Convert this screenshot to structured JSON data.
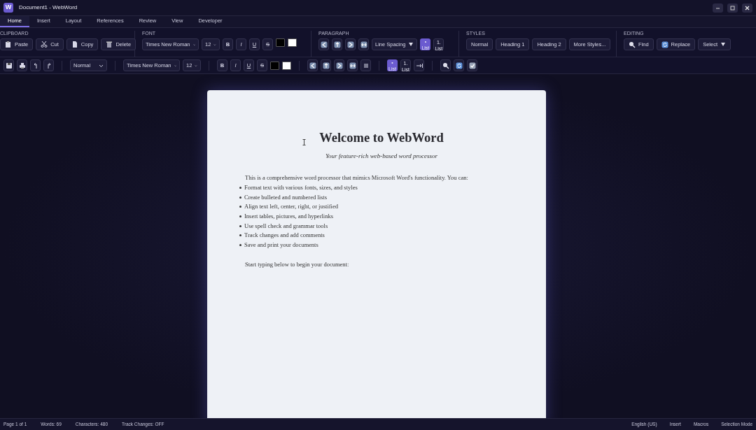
{
  "window": {
    "title": "Document1 - WebWord",
    "logo": "W"
  },
  "tabs": [
    {
      "label": "Home",
      "selected": true
    },
    {
      "label": "Insert",
      "selected": false
    },
    {
      "label": "Layout",
      "selected": false
    },
    {
      "label": "References",
      "selected": false
    },
    {
      "label": "Review",
      "selected": false
    },
    {
      "label": "View",
      "selected": false
    },
    {
      "label": "Developer",
      "selected": false
    }
  ],
  "ribbon": {
    "clipboard": {
      "title": "CLIPBOARD",
      "buttons": [
        "Paste",
        "Cut",
        "Copy",
        "Delete"
      ]
    },
    "font": {
      "title": "FONT",
      "font": "Times New Roman",
      "size": "12",
      "format": [
        "B",
        "I",
        "U",
        "S"
      ],
      "swatches": [
        {
          "color": "#000000"
        },
        {
          "color": "#ffffff"
        }
      ]
    },
    "paragraph": {
      "title": "PARAGRAPH",
      "line_spacing": "Line Spacing",
      "lists": [
        {
          "marker": "•",
          "label": "List",
          "selected": true
        },
        {
          "marker": "1.",
          "label": "List",
          "selected": false
        }
      ]
    },
    "styles": {
      "title": "STYLES",
      "buttons": [
        "Normal",
        "Heading 1",
        "Heading 2",
        "More Styles..."
      ]
    },
    "editing": {
      "title": "EDITING",
      "buttons": [
        "Find",
        "Replace",
        "Select"
      ]
    }
  },
  "toolbar": {
    "style": "Normal",
    "font": "Times New Roman",
    "size": "12",
    "format": [
      "B",
      "I",
      "U",
      "S"
    ],
    "swatches": [
      {
        "color": "#000000"
      },
      {
        "color": "#ffffff"
      }
    ],
    "lists": [
      {
        "marker": "•",
        "label": "List",
        "selected": true
      },
      {
        "marker": "1.",
        "label": "List",
        "selected": false
      }
    ]
  },
  "document": {
    "title": "Welcome to WebWord",
    "subtitle": "Your feature-rich web-based word processor",
    "intro": "This is a comprehensive word processor that mimics Microsoft Word's functionality. You can:",
    "bullets": [
      "Format text with various fonts, sizes, and styles",
      "Create bulleted and numbered lists",
      "Align text left, center, right, or justified",
      "Insert tables, pictures, and hyperlinks",
      "Use spell check and grammar tools",
      "Track changes and add comments",
      "Save and print your documents"
    ],
    "closing": "Start typing below to begin your document:"
  },
  "status_bar": {
    "left": [
      "Page 1 of 1",
      "Words: 69",
      "Characters: 480",
      "Track Changes: OFF"
    ],
    "right": [
      "English (US)",
      "Insert",
      "Macros",
      "Selection Mode"
    ]
  }
}
